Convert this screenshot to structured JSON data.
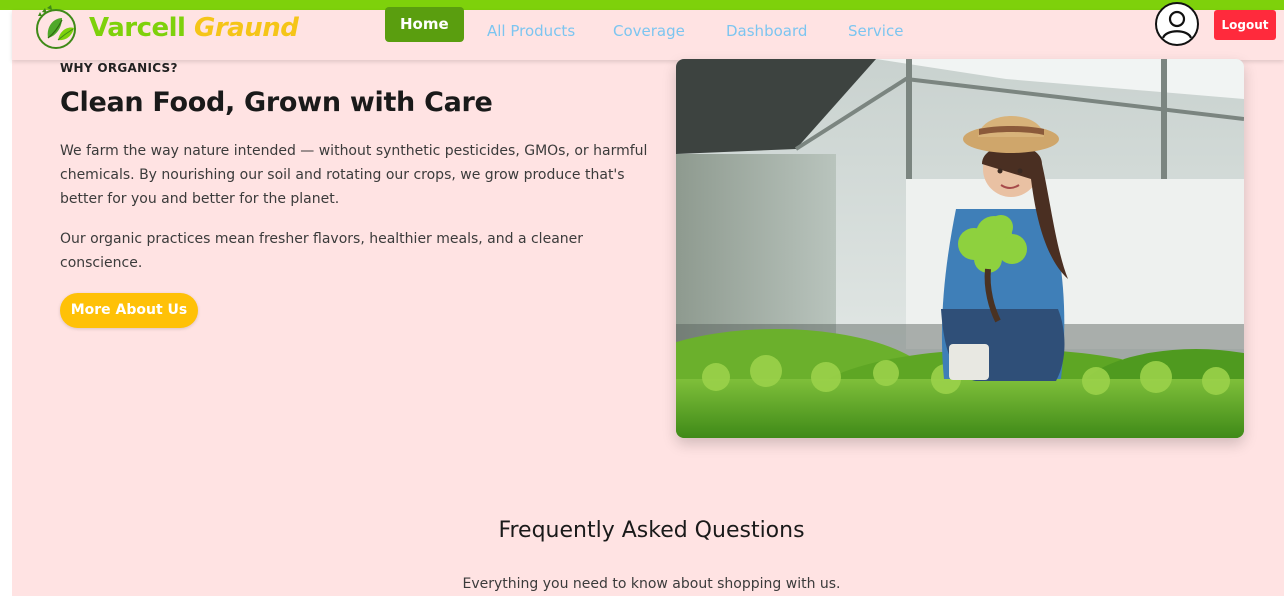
{
  "brand": {
    "word1": "Varcell",
    "word2": "Graund"
  },
  "nav": {
    "items": [
      {
        "label": "Home",
        "active": true
      },
      {
        "label": "All Products",
        "active": false
      },
      {
        "label": "Coverage",
        "active": false
      },
      {
        "label": "Dashboard",
        "active": false
      },
      {
        "label": "Service",
        "active": false
      }
    ],
    "logout_label": "Logout"
  },
  "hero": {
    "eyebrow": "WHY ORGANICS?",
    "headline": "Clean Food, Grown with Care",
    "paragraph1": "We farm the way nature intended — without synthetic pesticides, GMOs, or harmful chemicals. By nourishing our soil and rotating our crops, we grow produce that's better for you and better for the planet.",
    "paragraph2": "Our organic practices mean fresher flavors, healthier meals, and a cleaner conscience.",
    "cta_label": "More About Us"
  },
  "faq": {
    "title": "Frequently Asked Questions",
    "subtitle": "Everything you need to know about shopping with us."
  },
  "colors": {
    "accent_green": "#7ed10b",
    "active_nav": "#5a9e0f",
    "brand_yellow": "#f5c518",
    "cta_yellow": "#ffc107",
    "logout_red": "#ff2a3c",
    "nav_link": "#7cc5f0",
    "background": "#ffe3e3"
  }
}
